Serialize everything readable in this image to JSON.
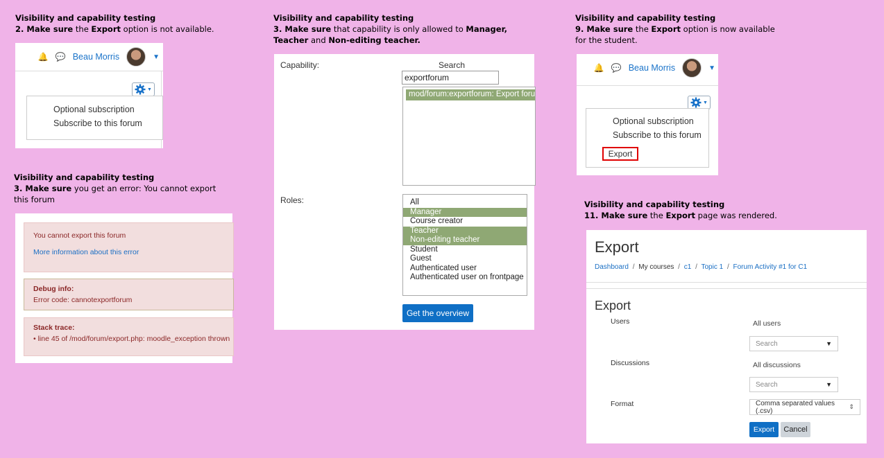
{
  "common_heading": "Visibility and capability testing",
  "step2": {
    "prefix": "2. ",
    "make": "Make sure",
    "mid": " the ",
    "bold": "Export",
    "rest": " option is not available."
  },
  "step3err": {
    "prefix": "3. ",
    "make": "Make sure",
    "rest": " you get an error: You cannot export this forum"
  },
  "step3cap": {
    "prefix": "3. ",
    "make": "Make sure",
    "rest1": " that capability is only allowed to ",
    "b1": "Manager,",
    "sp": " ",
    "b2": "Teacher",
    "and": " and ",
    "b3": "Non-editing teacher."
  },
  "step9": {
    "prefix": "9. ",
    "make": "Make sure",
    "mid": " the ",
    "bold": "Export",
    "rest": " option is now available for the student."
  },
  "step11": {
    "prefix": "11. ",
    "make": "Make sure",
    "mid": " the ",
    "bold": "Export",
    "rest": " page was rendered."
  },
  "user_name": "Beau Morris",
  "menu": {
    "optional": "Optional subscription",
    "subscribe": "Subscribe to this forum",
    "export": "Export"
  },
  "error": {
    "message": "You cannot export this forum",
    "more_info": "More information about this error",
    "debug_title": "Debug info:",
    "debug_text": "Error code: cannotexportforum",
    "stack_title": "Stack trace:",
    "stack_item": "line 45 of /mod/forum/export.php: moodle_exception thrown"
  },
  "capability": {
    "label": "Capability:",
    "search_label": "Search",
    "search_value": "exportforum",
    "selected": "mod/forum:exportforum: Export forum",
    "roles_label": "Roles:",
    "roles": [
      {
        "name": "All",
        "selected": false
      },
      {
        "name": "Manager",
        "selected": true
      },
      {
        "name": "Course creator",
        "selected": false
      },
      {
        "name": "Teacher",
        "selected": true
      },
      {
        "name": "Non-editing teacher",
        "selected": true
      },
      {
        "name": "Student",
        "selected": false
      },
      {
        "name": "Guest",
        "selected": false
      },
      {
        "name": "Authenticated user",
        "selected": false
      },
      {
        "name": "Authenticated user on frontpage",
        "selected": false
      }
    ],
    "button": "Get the overview"
  },
  "export_page": {
    "title": "Export",
    "breadcrumb": [
      "Dashboard",
      "My courses",
      "c1",
      "Topic 1",
      "Forum Activity #1 for C1"
    ],
    "section_title": "Export",
    "users_label": "Users",
    "users_value": "All users",
    "discussions_label": "Discussions",
    "discussions_value": "All discussions",
    "search_placeholder": "Search",
    "format_label": "Format",
    "format_value": "Comma separated values (.csv)",
    "export_button": "Export",
    "cancel_button": "Cancel"
  },
  "colors": {
    "background": "#f0b3e8",
    "link": "#1a73c9",
    "selected_row": "#8fa874",
    "primary_button": "#0f6fc5",
    "error_bg": "#f2dede",
    "highlight_border": "#e00000"
  }
}
